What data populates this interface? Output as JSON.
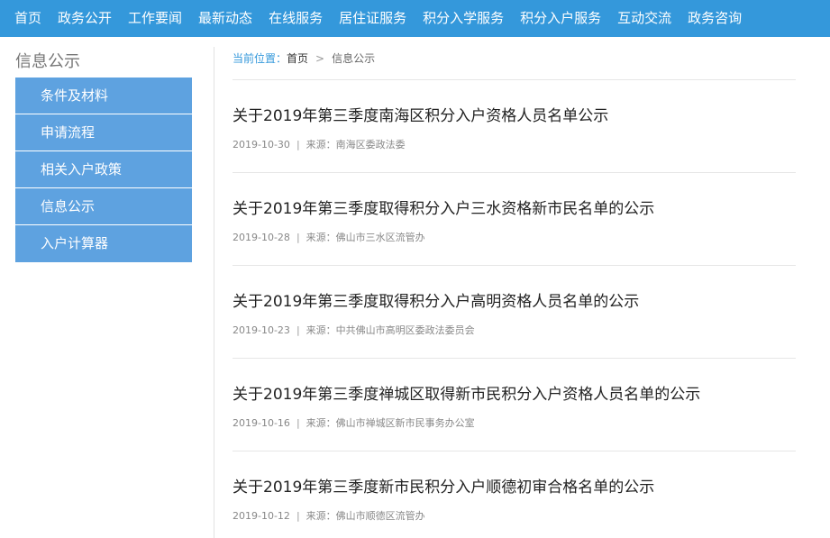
{
  "nav": {
    "items": [
      "首页",
      "政务公开",
      "工作要闻",
      "最新动态",
      "在线服务",
      "居住证服务",
      "积分入学服务",
      "积分入户服务",
      "互动交流",
      "政务咨询"
    ]
  },
  "sidebar": {
    "title": "信息公示",
    "items": [
      "条件及材料",
      "申请流程",
      "相关入户政策",
      "信息公示",
      "入户计算器"
    ]
  },
  "breadcrumb": {
    "label": "当前位置：",
    "home": "首页",
    "separator": ">",
    "current": "信息公示"
  },
  "articles": [
    {
      "title": "关于2019年第三季度南海区积分入户资格人员名单公示",
      "date": "2019-10-30",
      "separator": "|",
      "source": "来源：南海区委政法委"
    },
    {
      "title": "关于2019年第三季度取得积分入户三水资格新市民名单的公示",
      "date": "2019-10-28",
      "separator": "|",
      "source": "来源：佛山市三水区流管办"
    },
    {
      "title": "关于2019年第三季度取得积分入户高明资格人员名单的公示",
      "date": "2019-10-23",
      "separator": "|",
      "source": "来源：中共佛山市高明区委政法委员会"
    },
    {
      "title": "关于2019年第三季度禅城区取得新市民积分入户资格人员名单的公示",
      "date": "2019-10-16",
      "separator": "|",
      "source": "来源：佛山市禅城区新市民事务办公室"
    },
    {
      "title": "关于2019年第三季度新市民积分入户顺德初审合格名单的公示",
      "date": "2019-10-12",
      "separator": "|",
      "source": "来源：佛山市顺德区流管办"
    }
  ],
  "colors": {
    "nav_bg": "#3498db",
    "sidebar_item_bg": "#5ea2e0",
    "accent": "#3498db"
  }
}
